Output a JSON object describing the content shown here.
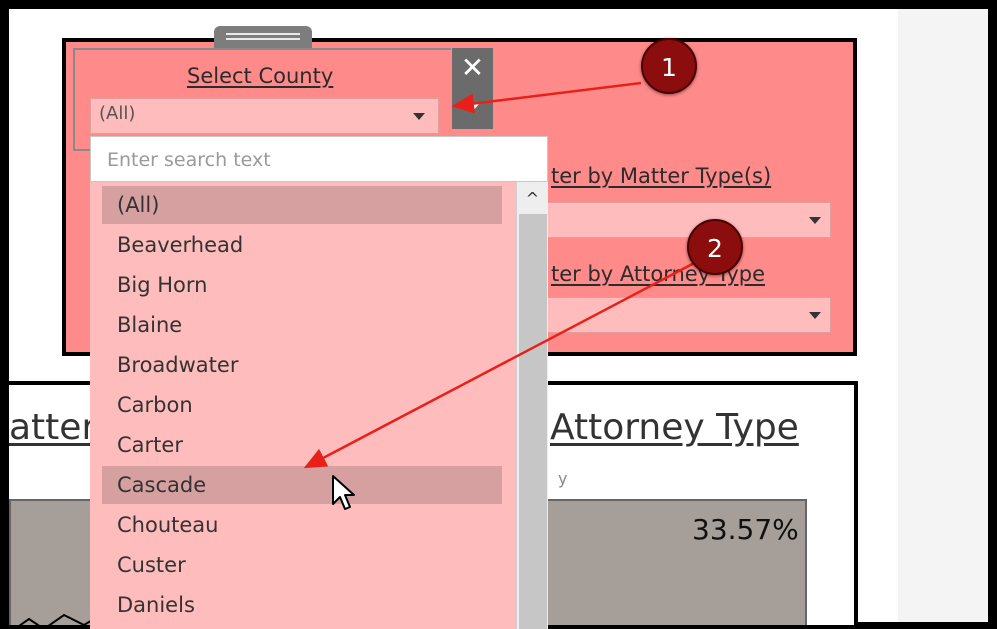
{
  "filters": {
    "county": {
      "title": "Select County",
      "value": "(All)"
    },
    "matter_type": {
      "title": "ter by Matter Type(s)"
    },
    "attorney_type": {
      "title": "ter by Attorney Type"
    },
    "close_glyph": "✕"
  },
  "dropdown": {
    "search_placeholder": "Enter search text",
    "scroll_up_glyph": "^",
    "items": [
      "(All)",
      "Beaverhead",
      "Big Horn",
      "Blaine",
      "Broadwater",
      "Carbon",
      "Carter",
      "Cascade",
      "Chouteau",
      "Custer",
      "Daniels"
    ],
    "selected_index": 0,
    "hovered_index": 7
  },
  "sheet": {
    "left_title": "atter",
    "right_title": "Attorney Type",
    "subtle_text": "y",
    "percent": "33.57%"
  },
  "annotations": {
    "step1": "1",
    "step2": "2",
    "arrow_color": "#e8201a",
    "marker_color": "#8b0d0d"
  },
  "colors": {
    "panel_bg": "#ff8a8a",
    "list_bg": "#ffbcbc",
    "highlight": "#d6a0a0"
  },
  "icons": [
    "close-icon",
    "chevron-down-icon",
    "chevron-up-icon",
    "mouse-pointer-icon",
    "drag-handle-icon"
  ]
}
